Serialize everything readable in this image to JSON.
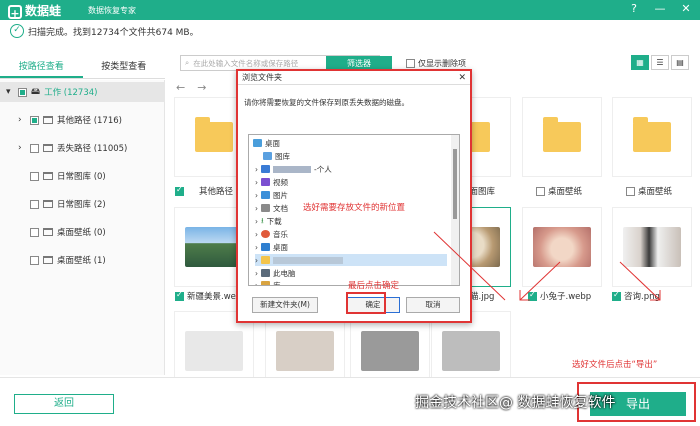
{
  "app": {
    "logo": "数据蛙",
    "subtitle": "数据恢复专家",
    "help": "?",
    "minimize": "—",
    "close": "✕"
  },
  "status": {
    "text": "扫描完成。找到12734个文件共674 MB。"
  },
  "tabs": [
    "按路径查看",
    "按类型查看"
  ],
  "search": {
    "placeholder": "在此处输入文件名称或保存路径"
  },
  "filter_label": "筛选器",
  "only_deleted_label": "仅显示删除项",
  "tree": [
    {
      "label": "工作 (12734)"
    },
    {
      "label": "其他路径 (1716)"
    },
    {
      "label": "丢失路径 (11005)"
    },
    {
      "label": "日常图库 (0)"
    },
    {
      "label": "日常图库 (2)"
    },
    {
      "label": "桌面壁纸 (0)"
    },
    {
      "label": "桌面壁纸 (1)"
    }
  ],
  "cards": [
    {
      "name": "其他路径"
    },
    {
      "name": "桌面图库"
    },
    {
      "name": "桌面壁纸"
    },
    {
      "name": "桌面壁纸"
    },
    {
      "name": "新疆美景.webp"
    },
    {
      "name": "猫.jpg"
    },
    {
      "name": "小兔子.webp"
    },
    {
      "name": "咨询.png"
    }
  ],
  "dialog": {
    "title": "浏览文件夹",
    "message": "请你将需要恢复的文件保存到原丢失数据的磁盘。",
    "tree": [
      "桌面",
      "图库",
      "-个人",
      "视频",
      "图片",
      "文档",
      "下载",
      "音乐",
      "桌面",
      "此电脑",
      "库"
    ],
    "new_folder": "新建文件夹(M)",
    "ok": "确定",
    "cancel": "取消"
  },
  "annotations": {
    "pick": "选好需要存放文件的新位置",
    "confirm": "最后点击确定",
    "export": "选好文件后点击“导出”"
  },
  "footer": {
    "back": "返回",
    "export": "导出"
  },
  "watermark": "掘金技术社区@ 数据蛙恢复软件"
}
